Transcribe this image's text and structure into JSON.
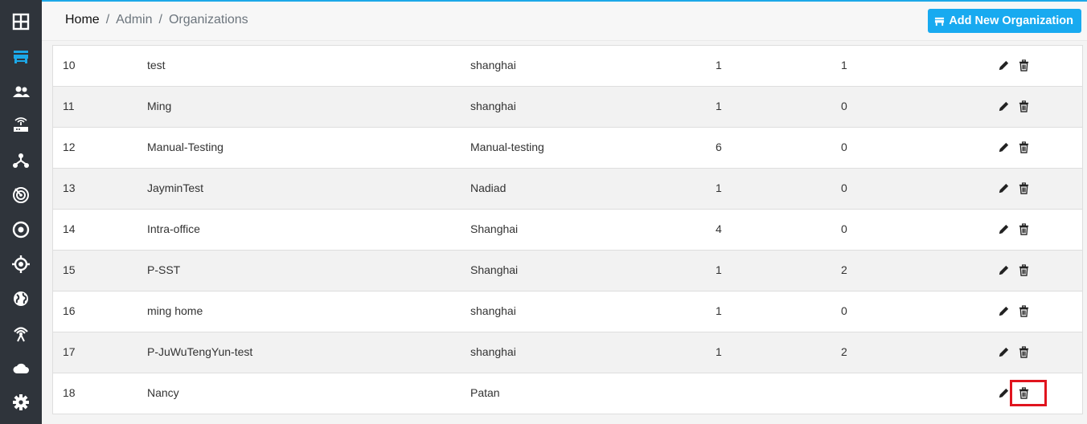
{
  "breadcrumb": {
    "home": "Home",
    "separator": "/",
    "admin": "Admin",
    "current": "Organizations"
  },
  "toolbar": {
    "add_label": "Add New Organization"
  },
  "colors": {
    "accent": "#18aaf0",
    "sidebar_bg": "#2f343b",
    "sidebar_active": "#1ca8e8",
    "highlight": "#e0141e"
  },
  "sidebar": {
    "items": [
      {
        "icon": "dashboard-icon"
      },
      {
        "icon": "store-icon",
        "active": true
      },
      {
        "icon": "users-icon"
      },
      {
        "icon": "router-icon"
      },
      {
        "icon": "network-icon"
      },
      {
        "icon": "radar-icon"
      },
      {
        "icon": "target-icon"
      },
      {
        "icon": "crosshair-icon"
      },
      {
        "icon": "globe-icon"
      },
      {
        "icon": "wireless-icon"
      },
      {
        "icon": "cloud-icon"
      },
      {
        "icon": "settings-icon"
      }
    ]
  },
  "table": {
    "rows": [
      {
        "id": "10",
        "name": "test",
        "city": "shanghai",
        "n1": "1",
        "n2": "1"
      },
      {
        "id": "11",
        "name": "Ming",
        "city": "shanghai",
        "n1": "1",
        "n2": "0"
      },
      {
        "id": "12",
        "name": "Manual-Testing",
        "city": "Manual-testing",
        "n1": "6",
        "n2": "0"
      },
      {
        "id": "13",
        "name": "JayminTest",
        "city": "Nadiad",
        "n1": "1",
        "n2": "0"
      },
      {
        "id": "14",
        "name": "Intra-office",
        "city": "Shanghai",
        "n1": "4",
        "n2": "0"
      },
      {
        "id": "15",
        "name": "P-SST",
        "city": "Shanghai",
        "n1": "1",
        "n2": "2"
      },
      {
        "id": "16",
        "name": "ming home",
        "city": "shanghai",
        "n1": "1",
        "n2": "0"
      },
      {
        "id": "17",
        "name": "P-JuWuTengYun-test",
        "city": "shanghai",
        "n1": "1",
        "n2": "2"
      },
      {
        "id": "18",
        "name": "Nancy",
        "city": "Patan",
        "n1": "",
        "n2": ""
      }
    ]
  }
}
